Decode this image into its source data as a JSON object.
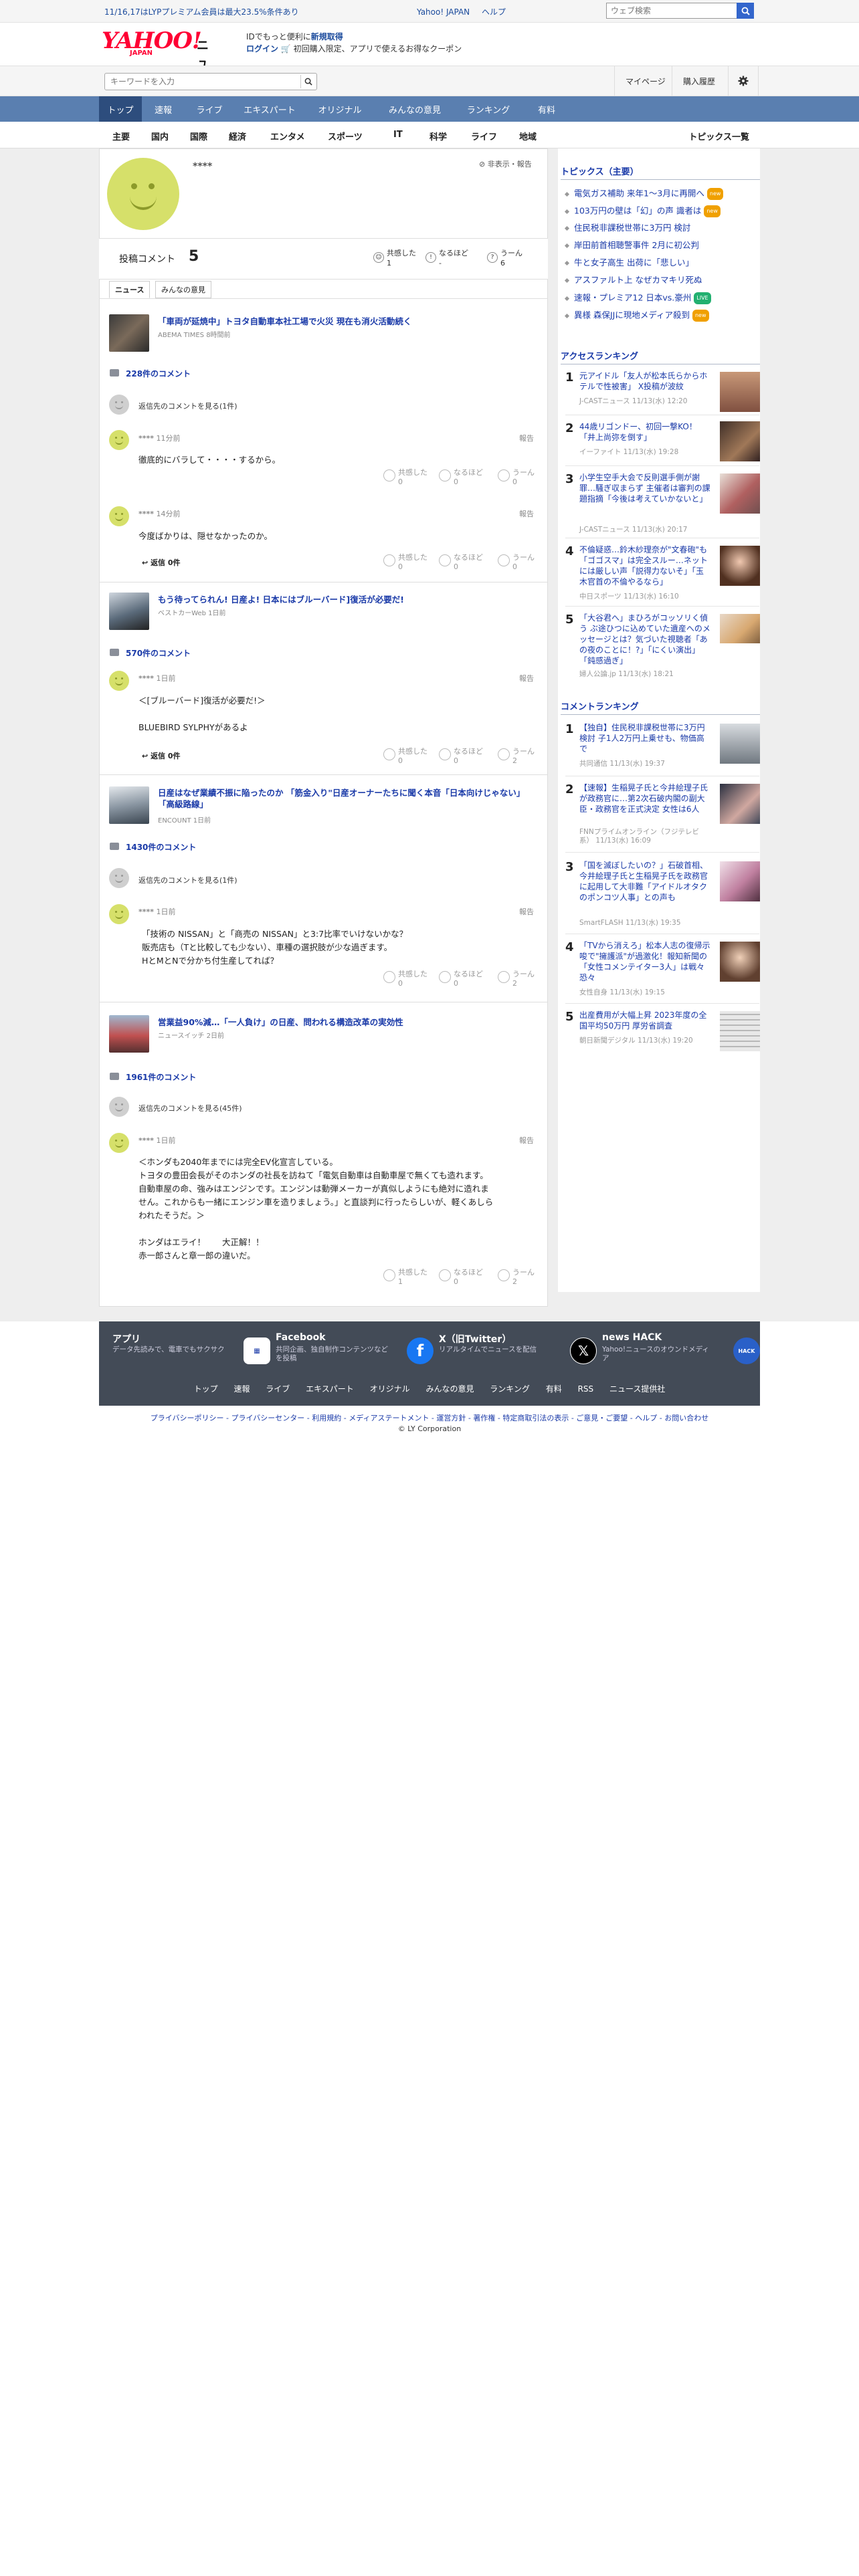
{
  "promo": {
    "text": "11/16,17はLYPプレミアム会員は最大23.5%条件あり",
    "links": [
      "Yahoo! JAPAN",
      "ヘルプ"
    ],
    "search_placeholder": "ウェブ検索"
  },
  "masthead": {
    "logo": "YAHOO!",
    "logo_sub": "JAPAN",
    "section": "ニュース",
    "msg_line1_pre": "IDでもっと便利に",
    "msg_line1_link": "新規取得",
    "msg_line2_link": "ログイン",
    "msg_line2_post": "🛒 初回購入限定、アプリで使えるお得なクーポン"
  },
  "search_row": {
    "placeholder": "キーワードを入力",
    "mypage": "マイページ",
    "history": "購入履歴"
  },
  "nav_primary": [
    "トップ",
    "速報",
    "ライブ",
    "エキスパート",
    "オリジナル",
    "みんなの意見",
    "ランキング",
    "有料"
  ],
  "nav_secondary": [
    "主要",
    "国内",
    "国際",
    "経済",
    "エンタメ",
    "スポーツ",
    "IT",
    "科学",
    "ライフ",
    "地域"
  ],
  "nav_secondary_all": "トピックス一覧",
  "profile": {
    "name": "****",
    "hide_report": "非表示・報告",
    "comments_label": "投稿コメント",
    "comments_count": "5",
    "reactions": [
      {
        "label": "共感した",
        "value": "1"
      },
      {
        "label": "なるほど",
        "value": "-"
      },
      {
        "label": "うーん",
        "value": "6"
      }
    ],
    "tabs": [
      "ニュース",
      "みんなの意見"
    ]
  },
  "articles": [
    {
      "title": "「車両が延焼中」トヨタ自動車本社工場で火災 現在も消火活動続く",
      "source": "ABEMA TIMES 8時間前",
      "comment_count": "228件のコメント",
      "see_reply": "返信先のコメントを見る(1件)",
      "comments": [
        {
          "user": "****",
          "time": "11分前",
          "report": "報告",
          "text": "徹底的にバラして・・・・するから。",
          "empathy": "0",
          "naruhodo": "0",
          "umm": "0"
        },
        {
          "user": "****",
          "time": "14分前",
          "report": "報告",
          "text": "今度ばかりは、隠せなかったのか。",
          "replies": "返信 0件",
          "empathy": "0",
          "naruhodo": "0",
          "umm": "0"
        }
      ]
    },
    {
      "title": "もう待ってられん! 日産よ! 日本にはブルーバード]復活が必要だ!",
      "source": "ベストカーWeb 1日前",
      "comment_count": "570件のコメント",
      "comments": [
        {
          "user": "****",
          "time": "1日前",
          "report": "報告",
          "text1": "＜[ブルーバード]復活が必要だ!＞",
          "text2": "BLUEBIRD SYLPHYがあるよ",
          "replies": "返信 0件",
          "empathy": "0",
          "naruhodo": "0",
          "umm": "2"
        }
      ]
    },
    {
      "title": "日産はなぜ業績不振に陥ったのか 「筋金入り\"日産オーナーたちに聞く本音「日本向けじゃない」「高級路線」",
      "source": "ENCOUNT 1日前",
      "comment_count": "1430件のコメント",
      "see_reply": "返信先のコメントを見る(1件)",
      "comments": [
        {
          "user": "****",
          "time": "1日前",
          "report": "報告",
          "text1": "「技術の NISSAN」と「商売の NISSAN」と3:7比率でいけないかな？",
          "text2": "販売店も（Tと比較しても少ない）、車種の選択肢が少な過ぎます。",
          "text3": "HとMとNで分かち付生産してれば？",
          "empathy": "0",
          "naruhodo": "0",
          "umm": "2"
        }
      ]
    },
    {
      "title": "営業益90%減…「一人負け」の日産、問われる構造改革の実効性",
      "source": "ニュースイッチ 2日前",
      "comment_count": "1961件のコメント",
      "see_reply": "返信先のコメントを見る(45件)",
      "comments": [
        {
          "user": "****",
          "time": "1日前",
          "report": "報告",
          "text1": "＜ホンダも2040年までには完全EV化宣言している。",
          "text2": "トヨタの豊田会長がそのホンダの社長を訪ねて「電気自動車は自動車屋で無くても造れます。",
          "text3": "自動車屋の命、強みはエンジンです。エンジンは動弾メーカーが真似しようにも絶対に造れま",
          "text4": "せん。これからも一緒にエンジン車を造りましょう。」と直談判に行ったらしいが、軽くあしら",
          "text5": "われたそうだ。＞",
          "text6": "ホンダはエライ！　　大正解！！",
          "text7": "赤一郎さんと章一郎の違いだ。",
          "empathy": "1",
          "naruhodo": "0",
          "umm": "2"
        }
      ]
    }
  ],
  "reaction_labels": {
    "empathy": "共感した",
    "naruhodo": "なるほど",
    "umm": "うーん"
  },
  "sidebar": {
    "topics_title": "トピックス（主要）",
    "topics": [
      {
        "text": "電気ガス補助 来年1〜3月に再開へ",
        "badge": "new"
      },
      {
        "text": "103万円の壁は「幻」の声 識者は",
        "badge": "new"
      },
      {
        "text": "住民税非課税世帯に3万円 検討",
        "badge": ""
      },
      {
        "text": "岸田前首相聴警事件 2月に初公判",
        "badge": ""
      },
      {
        "text": "牛と女子高生 出荷に「悲しい」",
        "badge": ""
      },
      {
        "text": "アスファルト上 なぜカマキリ死ぬ",
        "badge": ""
      },
      {
        "text": "速報・プレミア12 日本vs.豪州",
        "badge": "LIVE"
      },
      {
        "text": "異様 森保JJに現地メディア殺到",
        "badge": "new"
      }
    ],
    "access_title": "アクセスランキング",
    "access": [
      {
        "rank": "1",
        "title": "元アイドル「友人が松本氏らからホテルで性被害」 X投稿が波紋",
        "meta": "J-CASTニュース 11/13(水) 12:20"
      },
      {
        "rank": "2",
        "title": "44歳リゴンドー、初回一撃KO！「井上尚弥を倒す」",
        "meta": "イーファイト 11/13(水) 19:28"
      },
      {
        "rank": "3",
        "title": "小学生空手大会で反則選手側が謝罪…騒ぎ収まらず 主催者は審判の課題指摘「今後は考えていかないと」",
        "meta": "J-CASTニュース 11/13(水) 20:17"
      },
      {
        "rank": "4",
        "title": "不倫疑惑…鈴木紗理奈が\"文春砲\"も「ゴゴスマ」は完全スルー…ネットには厳しい声「説得力ないそ」「玉木官首の不倫やるなら」",
        "meta": "中日スポーツ 11/13(水) 16:10"
      },
      {
        "rank": "5",
        "title": "「大谷君へ」まひろがコッソリく偵う ぶ途ひつに込めていた遺産へのメッセージとは？気づいた視聴者「あの夜のことに！?」「にくい演出」「鈍感過ぎ」",
        "meta": "婦人公論.jp 11/13(水) 18:21"
      }
    ],
    "comment_title": "コメントランキング",
    "comment": [
      {
        "rank": "1",
        "title": "【独自】住民税非課税世帯に3万円検討 子1人2万円上乗せも、物価高で",
        "meta": "共同通信 11/13(水) 19:37"
      },
      {
        "rank": "2",
        "title": "【速報】生稲晃子氏と今井絵理子氏が政務官に…第2次石破内閣の副大臣・政務官を正式決定 女性は6人",
        "meta": "FNNプライムオンライン（フジテレビ系） 11/13(水) 16:09"
      },
      {
        "rank": "3",
        "title": "「国を滅ぼしたいの？」石破首相、今井絵理子氏と生稲晃子氏を政務官に起用して大非難「アイドルオタクのポンコツ人事」との声も",
        "meta": "SmartFLASH 11/13(水) 19:35"
      },
      {
        "rank": "4",
        "title": "「TVから消えろ」松本人志の復帰示唆で\"擁護派\"が過激化！報知新聞の「女性コメンテイター3人」は戦々恐々",
        "meta": "女性自身 11/13(水) 19:15"
      },
      {
        "rank": "5",
        "title": "出産費用が大幅上昇 2023年度の全国平均50万円 厚労省調査",
        "meta": "朝日新聞デジタル 11/13(水) 19:20"
      }
    ]
  },
  "footer": {
    "cards": [
      {
        "title": "アプリ",
        "desc": "データ先読みで、電車でもサクサク",
        "icon": "news-app-icon"
      },
      {
        "title": "Facebook",
        "desc": "共同企画、独自制作コンテンツなどを投稿",
        "icon": "facebook-icon"
      },
      {
        "title": "X（旧Twitter）",
        "desc": "リアルタイムでニュースを配信",
        "icon": "x-icon"
      },
      {
        "title": "news HACK",
        "desc": "Yahoo!ニュースのオウンドメディア",
        "icon": "news-hack-icon"
      }
    ],
    "links": [
      "トップ",
      "速報",
      "ライブ",
      "エキスパート",
      "オリジナル",
      "みんなの意見",
      "ランキング",
      "有料",
      "RSS",
      "ニュース提供社"
    ],
    "bottom_links": "プライバシーポリシー - プライバシーセンター - 利用規約 - メディアステートメント - 運営方針 - 著作権 - 特定商取引法の表示 - ご意見・ご要望 - ヘルプ - お問い合わせ",
    "copyright": "© LY Corporation"
  },
  "colors": {
    "brand_red": "#ff0033",
    "nav_blue": "#5a7fb0",
    "link_blue": "#1a3aa8",
    "avatar_green": "#d6e06a"
  }
}
